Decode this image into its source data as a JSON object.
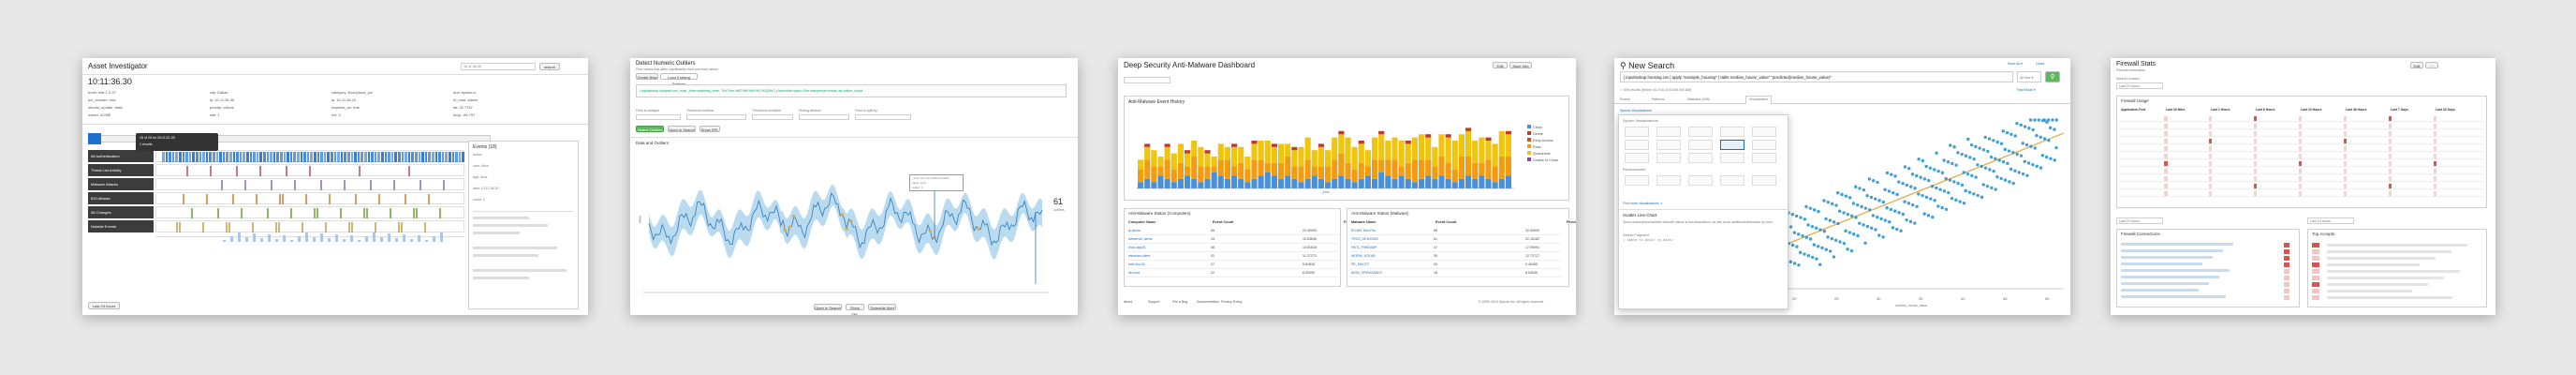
{
  "asset": {
    "title": "Asset Investigator",
    "time": "10:11:36.30",
    "search_value": "10.11.36.30",
    "search_btn": "search",
    "fields": [
      [
        "bunit",
        "mkt-1.0.37"
      ],
      [
        "city",
        "Dallas"
      ],
      [
        "category",
        "linux|cloud_pci"
      ],
      [
        "dns",
        "splunk.io"
      ],
      [
        "pci_domain",
        "true"
      ],
      [
        "ip",
        "10.11.36.30"
      ],
      [
        "ip",
        "10.11.36.10"
      ],
      [
        "nt_host",
        "admin"
      ],
      [
        "should_update",
        "false"
      ],
      [
        "priority",
        "critical"
      ],
      [
        "requires_av",
        "true"
      ],
      [
        "lat",
        "32.7767"
      ],
      [
        "owner",
        "ACME"
      ],
      [
        "site",
        "1"
      ],
      [
        "ext",
        "2"
      ],
      [
        "long",
        "-96.797"
      ]
    ],
    "tooltip": [
      "15 of 25 for 2013-02-28",
      "1 results"
    ],
    "swimlanes": [
      "All Authentication",
      "Threat List Activity",
      "Malware Attacks",
      "IDS Attacks",
      "All Changes",
      "Notable Events"
    ],
    "swim_colors": [
      "#1f6fd1",
      "#b34a6f",
      "#8b6fa8",
      "#c97e2a",
      "#6a9e3a",
      "#c0a040"
    ],
    "events_title": "Events (18)",
    "events": [
      "action",
      "user: Alice",
      "app: linux",
      "dest: 10.11.36.30",
      "count: 1"
    ],
    "footer": "Last 24 hours"
  },
  "outliers": {
    "title": "Detect Numeric Outliers",
    "subtitle": "Find values that differ significantly from previous values",
    "tabs": [
      "Create New",
      "Load Existing Settings"
    ],
    "query": "| inputlookup hostperf.csv | eval _time=strptime(_time, \"%Y-%m-%dT%H:%M:%S.%3Q%z\") | timechart span=10m max(rmvar=rmvar) as outlier_count",
    "form_labels": [
      "Field to analyze",
      "Threshold method",
      "Threshold multiplier",
      "Sliding window",
      "Field to split by"
    ],
    "buttons": [
      "Detect Outliers",
      "Open in Search",
      "Show SPL"
    ],
    "chart_title": "Data and Outliers",
    "ylabel": "value",
    "tooltip": [
      "_time: Dec 10, 2015 9:15 PM",
      "value: 12.9",
      "outlier: 1"
    ],
    "outlier_count": "61",
    "outlier_label": "outliers",
    "footer_btns": [
      "Open in Search",
      "Show SPL",
      "Schedule Alert"
    ]
  },
  "malware": {
    "title": "Deep Security Anti-Malware Dashboard",
    "panel_title": "Anti-Malware Event History",
    "legend": [
      "Clean",
      "Delete",
      "Deny Access",
      "Pass",
      "Quarantine",
      "Unable to Clean"
    ],
    "legend_colors": [
      "#4a90d9",
      "#c0392b",
      "#d35400",
      "#f39c12",
      "#f1c40f",
      "#8e44ad"
    ],
    "xlabel": "_time",
    "table1_title": "Anti-Malware Status (Computers)",
    "table2_title": "Anti-Malware Status (Malware)",
    "table1_cols": [
      "Computer Name",
      "Event Count",
      "Percent of Total"
    ],
    "table2_cols": [
      "Malware Name",
      "Event Count",
      "Percent of Total"
    ],
    "table1_rows": [
      [
        "ip-demo",
        "55",
        "20.00000"
      ],
      [
        "winserver-demo",
        "43",
        "15.63636"
      ],
      [
        "linux-app01",
        "38",
        "13.81818"
      ],
      [
        "windows-client",
        "31",
        "11.27273"
      ],
      [
        "web-srv-02",
        "27",
        "9.81818"
      ],
      [
        "db-host",
        "22",
        "8.00000"
      ]
    ],
    "table2_rows": [
      [
        "EICAR-Test-File",
        "88",
        "32.00000"
      ],
      [
        "TROJ_GEN.R002",
        "61",
        "22.18182"
      ],
      [
        "HKTL_PWDUMP",
        "47",
        "17.09091"
      ],
      [
        "WORM_KOLAB",
        "35",
        "12.72727"
      ],
      [
        "PE_SALITY",
        "26",
        "9.45455"
      ],
      [
        "ADW_OPENCANDY",
        "18",
        "6.54545"
      ]
    ],
    "footer": [
      "About",
      "Support",
      "File a Bug",
      "Documentation",
      "Privacy Policy"
    ],
    "copyright": "© 2005-2014 Splunk Inc. All rights reserved."
  },
  "search": {
    "title": "New Search",
    "save_as": "Save As ▾",
    "close": "Close",
    "query": "| inputlookup housing.csv | apply \"example_housing\" | table median_house_value\" \"predicted(median_house_value)\"",
    "time_picker": "All time ▾",
    "status": "✓ 506 results (before 4/17/16 10:03:56.000 AM)",
    "mode": "Fast Mode ▾",
    "tabs": [
      "Events",
      "Patterns",
      "Statistics (506)",
      "Visualization"
    ],
    "viz_menu_title": "Splunk Visualizations",
    "menu_header": "Splunk Visualizations",
    "recommended": "Recommended",
    "more": "Find more visualizations ↗",
    "selected_name": "Scatter Line Chart",
    "selected_desc": "Show relationships between discrete values in two dimensions, as well as an additional dimension by color",
    "search_fragment": "Search Fragment",
    "fragment_code": "| table <x-axis> <y-axis>",
    "xlabel": "median_house_value",
    "x_ticks": [
      "20",
      "25",
      "30",
      "35",
      "40",
      "45",
      "50"
    ]
  },
  "firewall": {
    "title": "Firewall Stats",
    "subtitle": "Firewall information",
    "filter_label": "Select Location",
    "filter_value": "Last 24 hours",
    "panel1_title": "Firewall Usage",
    "table_cols": [
      "Application Port",
      "Last 30 Mins",
      "Last 2 Hours",
      "Last 8 Hours",
      "Last 24 Hours",
      "Last 48 Hours",
      "Last 7 Days",
      "Last 30 Days"
    ],
    "panel2_title": "Firewall Connections",
    "panel3_title": "Top Accepts",
    "dropdown1": "Last 24 hours",
    "dropdown2": "Last 24 hours"
  },
  "chart_data": [
    {
      "type": "area",
      "title": "Data and Outliers",
      "ylabel": "value",
      "series": [
        {
          "name": "value"
        },
        {
          "name": "outlier"
        }
      ]
    },
    {
      "type": "bar",
      "title": "Anti-Malware Event History",
      "xlabel": "_time",
      "series": [
        {
          "name": "Clean",
          "values": [
            2,
            3,
            2,
            4,
            3,
            2,
            3,
            4,
            3,
            2,
            3,
            5,
            4,
            3,
            4,
            3,
            2,
            3,
            4,
            5,
            4,
            3,
            4,
            3,
            2,
            3,
            4,
            3,
            2,
            3,
            4,
            3,
            2,
            3,
            4,
            3,
            5,
            4,
            3,
            4,
            3,
            2,
            3,
            4,
            3,
            4,
            3,
            2,
            3,
            4,
            3,
            4,
            3,
            2,
            3,
            4
          ]
        },
        {
          "name": "Pass",
          "values": [
            4,
            6,
            5,
            3,
            6,
            4,
            5,
            3,
            7,
            5,
            4,
            2,
            5,
            6,
            3,
            5,
            4,
            6,
            5,
            3,
            4,
            5,
            6,
            4,
            5,
            6,
            3,
            4,
            5,
            6,
            7,
            5,
            4,
            5,
            3,
            6,
            4,
            5,
            6,
            3,
            5,
            7,
            6,
            5,
            4,
            6,
            5,
            4,
            7,
            6,
            5,
            4,
            6,
            5,
            7,
            6
          ]
        },
        {
          "name": "Quarantine",
          "values": [
            3,
            4,
            5,
            3,
            4,
            5,
            6,
            4,
            5,
            6,
            4,
            3,
            5,
            4,
            6,
            5,
            4,
            5,
            6,
            7,
            5,
            6,
            4,
            5,
            6,
            7,
            5,
            6,
            5,
            7,
            6,
            8,
            7,
            6,
            5,
            7,
            8,
            6,
            7,
            8,
            6,
            7,
            8,
            7,
            6,
            7,
            8,
            9,
            7,
            8,
            7,
            8,
            6,
            7,
            8,
            7
          ]
        },
        {
          "name": "Delete",
          "values": [
            0,
            1,
            0,
            0,
            1,
            0,
            0,
            1,
            0,
            0,
            1,
            0,
            0,
            0,
            1,
            0,
            0,
            1,
            0,
            0,
            1,
            0,
            0,
            1,
            0,
            0,
            0,
            1,
            0,
            0,
            1,
            0,
            0,
            1,
            0,
            0,
            1,
            0,
            0,
            0,
            1,
            0,
            0,
            1,
            0,
            0,
            1,
            0,
            0,
            1,
            0,
            0,
            1,
            0,
            0,
            1
          ]
        }
      ]
    },
    {
      "type": "scatter",
      "xlabel": "median_house_value",
      "x_ticks": [
        "20",
        "25",
        "30",
        "35",
        "40",
        "45",
        "50"
      ]
    }
  ]
}
